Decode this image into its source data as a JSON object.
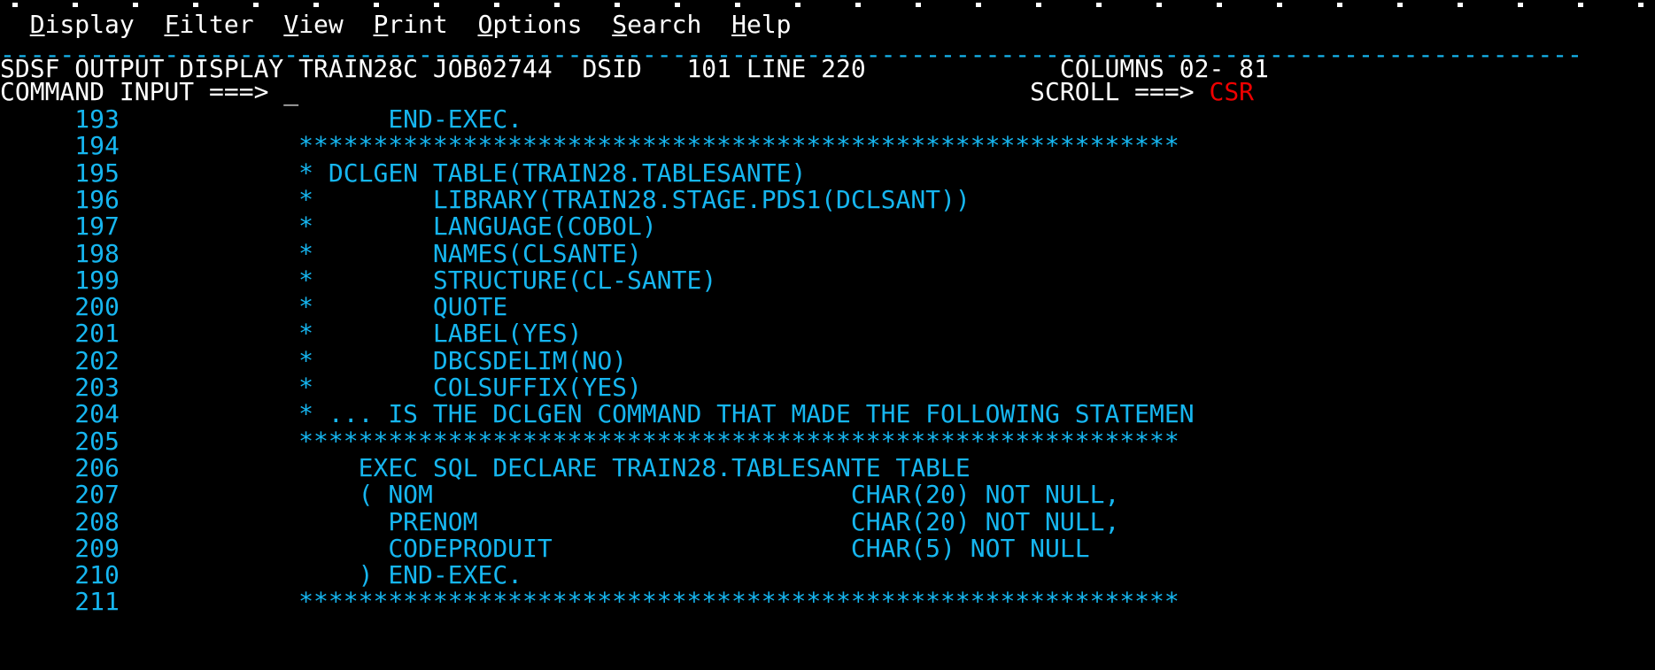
{
  "screen": {
    "app": "SDSF OUTPUT DISPLAY",
    "cols": 110,
    "rows": 24,
    "colors": {
      "background": "#000000",
      "primary_text": "#ffffff",
      "data_text": "#16b6f0",
      "alert_text": "#ee0000"
    }
  },
  "action_bar": {
    "items": [
      {
        "label": "Display",
        "mnemonic": "D",
        "rest": "isplay"
      },
      {
        "label": "Filter",
        "mnemonic": "F",
        "rest": "ilter"
      },
      {
        "label": "View",
        "mnemonic": "V",
        "rest": "iew"
      },
      {
        "label": "Print",
        "mnemonic": "P",
        "rest": "rint"
      },
      {
        "label": "Options",
        "mnemonic": "O",
        "rest": "ptions"
      },
      {
        "label": "Search",
        "mnemonic": "S",
        "rest": "earch"
      },
      {
        "label": "Help",
        "mnemonic": "H",
        "rest": "elp"
      }
    ]
  },
  "separator": "----------------------------------------------------------------------------------------------------------",
  "title_line": {
    "left": "SDSF OUTPUT DISPLAY TRAIN28C JOB02744  DSID   101 LINE 220",
    "panel": "SDSF OUTPUT DISPLAY",
    "jobname": "TRAIN28C",
    "jobid": "JOB02744",
    "dsid_label": "DSID",
    "dsid_value": "101",
    "line_label": "LINE",
    "line_value": "220",
    "right": "COLUMNS 02- 81",
    "columns_label": "COLUMNS",
    "columns_value": "02- 81"
  },
  "command_line": {
    "prompt": "COMMAND INPUT ===>",
    "value": "",
    "cursor": "_",
    "scroll_label": "SCROLL ===>",
    "scroll_value": "CSR"
  },
  "output": {
    "lines": [
      {
        "number": "193",
        "text": "        END-EXEC."
      },
      {
        "number": "194",
        "text": "  ***********************************************************"
      },
      {
        "number": "195",
        "text": "  * DCLGEN TABLE(TRAIN28.TABLESANTE)"
      },
      {
        "number": "196",
        "text": "  *        LIBRARY(TRAIN28.STAGE.PDS1(DCLSANT))"
      },
      {
        "number": "197",
        "text": "  *        LANGUAGE(COBOL)"
      },
      {
        "number": "198",
        "text": "  *        NAMES(CLSANTE)"
      },
      {
        "number": "199",
        "text": "  *        STRUCTURE(CL-SANTE)"
      },
      {
        "number": "200",
        "text": "  *        QUOTE"
      },
      {
        "number": "201",
        "text": "  *        LABEL(YES)"
      },
      {
        "number": "202",
        "text": "  *        DBCSDELIM(NO)"
      },
      {
        "number": "203",
        "text": "  *        COLSUFFIX(YES)"
      },
      {
        "number": "204",
        "text": "  * ... IS THE DCLGEN COMMAND THAT MADE THE FOLLOWING STATEMEN"
      },
      {
        "number": "205",
        "text": "  ***********************************************************"
      },
      {
        "number": "206",
        "text": "      EXEC SQL DECLARE TRAIN28.TABLESANTE TABLE"
      },
      {
        "number": "207",
        "text": "      ( NOM                            CHAR(20) NOT NULL,"
      },
      {
        "number": "208",
        "text": "        PRENOM                         CHAR(20) NOT NULL,"
      },
      {
        "number": "209",
        "text": "        CODEPRODUIT                    CHAR(5) NOT NULL"
      },
      {
        "number": "210",
        "text": "      ) END-EXEC."
      },
      {
        "number": "211",
        "text": "  ***********************************************************"
      }
    ]
  }
}
